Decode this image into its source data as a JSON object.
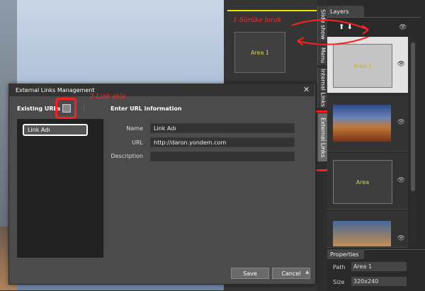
{
  "top_panel": {
    "area_label": "Area 1",
    "annotation": "1-Sürüke bırak"
  },
  "side_tabs": [
    {
      "label": "Slide show"
    },
    {
      "label": "Menu"
    },
    {
      "label": "Internal Links"
    },
    {
      "label": "External Links"
    }
  ],
  "layers": {
    "title": "Layers",
    "arrow_up": "⬆",
    "arrow_down": "⬇",
    "eye": "👁",
    "rows": [
      {
        "label": "Area 1"
      },
      {
        "label": ""
      },
      {
        "label": "Area"
      },
      {
        "label": ""
      }
    ]
  },
  "properties": {
    "title": "Properties",
    "path_label": "Path",
    "path_value": "Area 1",
    "size_label": "Size",
    "size_value": "320x240"
  },
  "dialog": {
    "title": "External Links Management",
    "close": "✕",
    "existing_label": "Existing URLs",
    "annotation": "2-Link ekle",
    "list_items": [
      "Link Adı"
    ],
    "enter_label": "Enter URL information",
    "name_label": "Name",
    "name_value": "Link Adı",
    "url_label": "URL",
    "url_value": "http://daron.yondem.com",
    "desc_label": "Description",
    "desc_value": "",
    "save": "Save",
    "cancel": "Cancel",
    "scroll_glyph": "▲"
  },
  "colors": {
    "highlight": "#ff1f1f",
    "accent_yellow": "#e6e600"
  }
}
